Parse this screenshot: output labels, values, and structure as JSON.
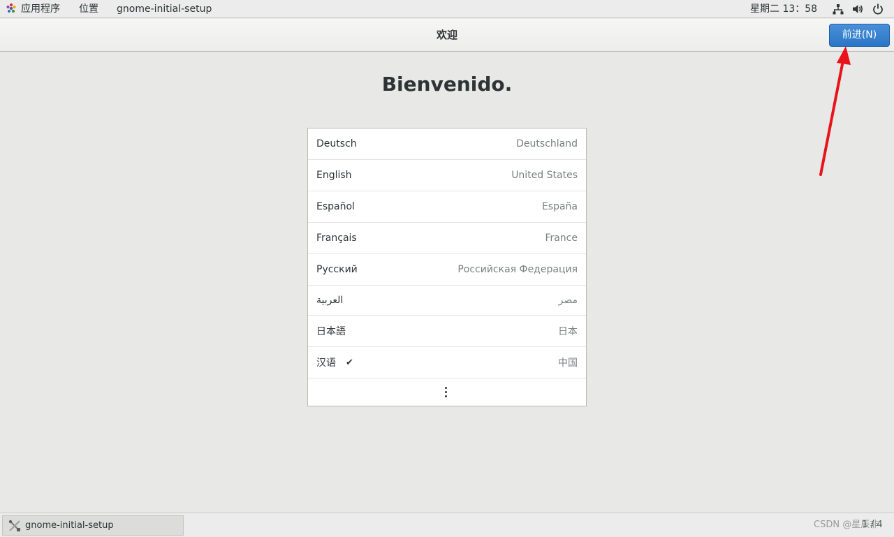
{
  "top_panel": {
    "apps_menu_label": "应用程序",
    "places_menu_label": "位置",
    "app_title": "gnome-initial-setup",
    "clock": "星期二 13：58",
    "tray_icons": [
      "network-icon",
      "volume-icon",
      "power-icon"
    ]
  },
  "header": {
    "title": "欢迎",
    "next_button_label": "前进(N)"
  },
  "main": {
    "heading": "Bienvenido.",
    "languages": [
      {
        "name": "Deutsch",
        "region": "Deutschland",
        "selected": false
      },
      {
        "name": "English",
        "region": "United States",
        "selected": false
      },
      {
        "name": "Español",
        "region": "España",
        "selected": false
      },
      {
        "name": "Français",
        "region": "France",
        "selected": false
      },
      {
        "name": "Русский",
        "region": "Российская Федерация",
        "selected": false
      },
      {
        "name": "العربية",
        "region": "مصر",
        "selected": false
      },
      {
        "name": "日本語",
        "region": "日本",
        "selected": false
      },
      {
        "name": "汉语",
        "region": "中国",
        "selected": true
      }
    ],
    "check_glyph": "✔",
    "more_icon": "vertical-ellipsis-icon"
  },
  "bottom_panel": {
    "task_label": "gnome-initial-setup",
    "watermark": "CSDN @星辰非",
    "workspace": "1 / 4"
  },
  "colors": {
    "accent": "#2a76c6",
    "annotation": "#e8131b",
    "background": "#e8e8e7"
  }
}
